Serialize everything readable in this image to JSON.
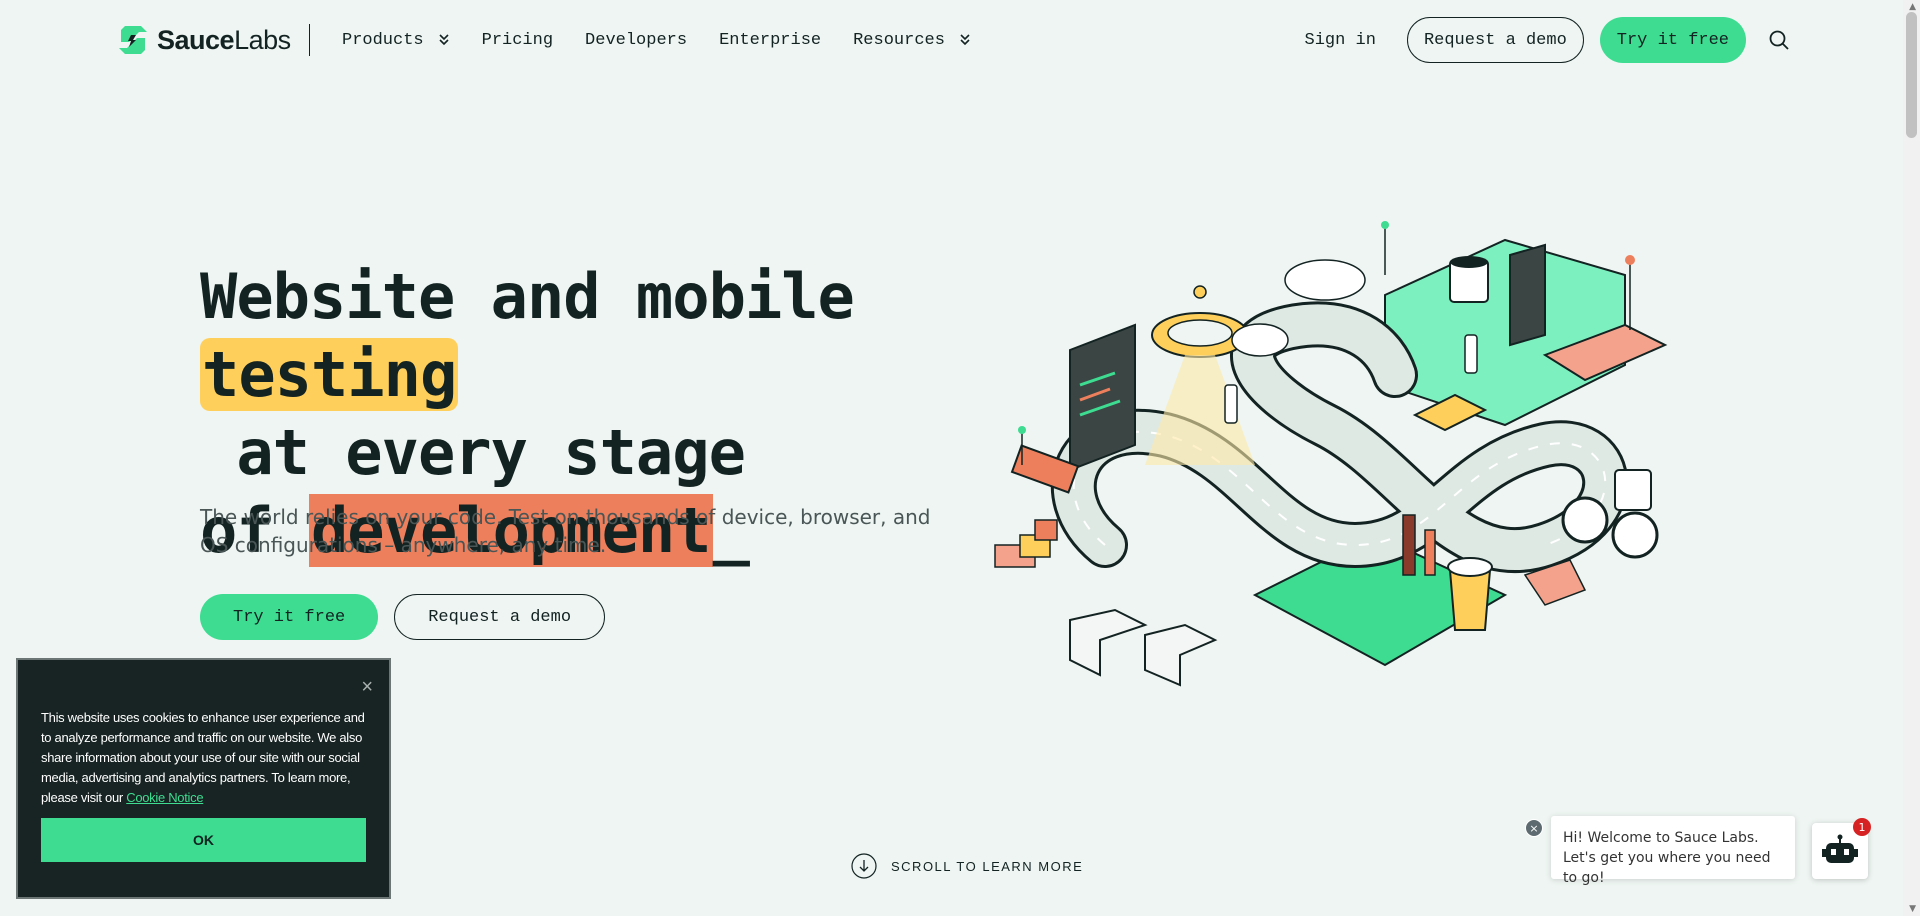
{
  "brand": {
    "name_part1": "Sauce",
    "name_part2": "Labs",
    "accent": "#3ddc91"
  },
  "nav": {
    "items": [
      {
        "label": "Products",
        "has_dropdown": true
      },
      {
        "label": "Pricing",
        "has_dropdown": false
      },
      {
        "label": "Developers",
        "has_dropdown": false
      },
      {
        "label": "Enterprise",
        "has_dropdown": false
      },
      {
        "label": "Resources",
        "has_dropdown": true
      }
    ],
    "sign_in": "Sign in",
    "request_demo": "Request a demo",
    "try_free": "Try it free",
    "search_icon": "search-icon"
  },
  "hero": {
    "title_line1": "Website and mobile",
    "title_highlight1": "testing",
    "title_line2_rest": " at every stage",
    "title_line3_prefix": "of ",
    "title_highlight2": "development",
    "title_cursor": "_",
    "subtitle": "The world relies on your code. Test on thousands of device, browser, and OS configurations – anywhere, any time.",
    "cta_primary": "Try it free",
    "cta_secondary": "Request a demo",
    "highlight_yellow": "#ffcf5c",
    "highlight_orange": "#ee7f5c"
  },
  "scroll_hint": "SCROLL TO LEARN MORE",
  "cookie": {
    "text": "This website uses cookies to enhance user experience and to analyze performance and traffic on our website. We also share information about your use of our site with our social media, advertising and analytics partners. To learn more, please visit our ",
    "link": "Cookie Notice",
    "ok": "OK",
    "close": "×"
  },
  "chat": {
    "message": "Hi! Welcome to Sauce Labs. Let's get you where you need to go!",
    "badge_count": "1",
    "close": "×"
  }
}
